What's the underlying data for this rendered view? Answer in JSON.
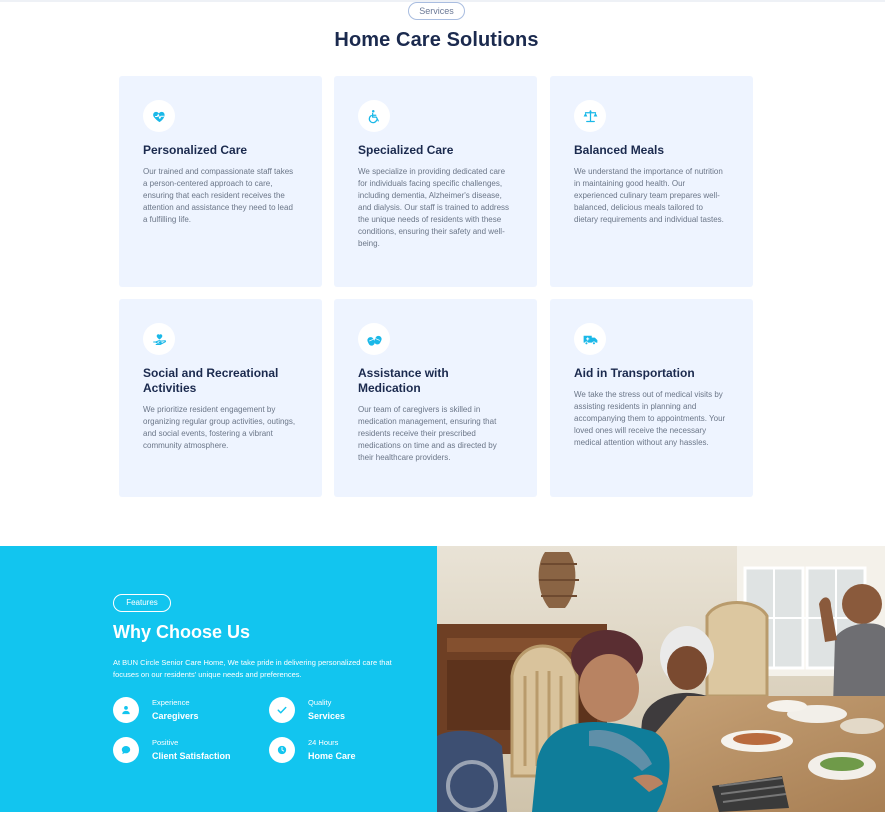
{
  "services_section": {
    "pill": "Services",
    "title": "Home Care Solutions",
    "cards": [
      {
        "title": "Personalized Care",
        "icon": "heart-pulse-icon",
        "text": "Our trained and compassionate staff takes a person-centered approach to care, ensuring that each resident receives the attention and assistance they need to lead a fulfilling life."
      },
      {
        "title": "Specialized Care",
        "icon": "wheelchair-icon",
        "text": "We specialize in providing dedicated care for individuals facing specific challenges, including dementia, Alzheimer's disease, and dialysis. Our staff is trained to address the unique needs of residents with these conditions, ensuring their safety and well-being."
      },
      {
        "title": "Balanced Meals",
        "icon": "scale-balance-icon",
        "text": "We understand the importance of nutrition in maintaining good health. Our experienced culinary team prepares well-balanced, delicious meals tailored to dietary requirements and individual tastes."
      },
      {
        "title": "Social and Recreational Activities",
        "icon": "hand-heart-icon",
        "text": "We prioritize resident engagement by organizing regular group activities, outings, and social events, fostering a vibrant community atmosphere."
      },
      {
        "title": "Assistance with Medication",
        "icon": "pills-icon",
        "text": "Our team of caregivers is skilled in medication management, ensuring that residents receive their prescribed medications on time and as directed by their healthcare providers."
      },
      {
        "title": "Aid in Transportation",
        "icon": "ambulance-icon",
        "text": "We take the stress out of medical visits by assisting residents in planning and accompanying them to appointments. Your loved ones will receive the necessary medical attention without any hassles."
      }
    ]
  },
  "why_section": {
    "pill": "Features",
    "title": "Why Choose Us",
    "description": "At BUN Circle Senior Care Home, We take pride in delivering personalized care that focuses on our residents' unique needs and preferences.",
    "features": [
      {
        "small": "Experience",
        "big": "Caregivers",
        "icon": "user-icon"
      },
      {
        "small": "Quality",
        "big": "Services",
        "icon": "check-icon"
      },
      {
        "small": "Positive",
        "big": "Client Satisfaction",
        "icon": "chat-icon"
      },
      {
        "small": "24 Hours",
        "big": "Home Care",
        "icon": "clock-icon"
      }
    ],
    "image_alt": "Seniors sharing a meal at a dining table"
  },
  "colors": {
    "accent": "#12c5ef",
    "icon_color": "#1ab8e8",
    "card_bg": "#eef4ff",
    "heading": "#1b2a4e"
  }
}
